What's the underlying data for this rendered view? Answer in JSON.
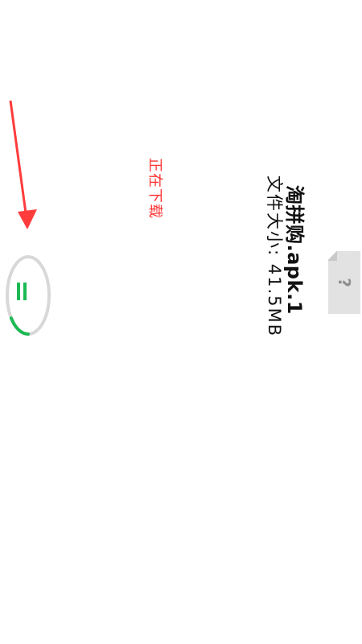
{
  "download": {
    "file_name": "淘拼购.apk.1",
    "file_size_label": "文件大小: 41.5MB",
    "status": "正在下载",
    "file_icon_glyph": "?",
    "progress": 0.15
  },
  "colors": {
    "accent_green": "#1db954",
    "status_red": "#ff3333",
    "ring_gray": "#d8d8d8",
    "arrow_red": "#ff3b3b"
  },
  "icons": [
    "file-icon",
    "pause-icon",
    "arrow-icon"
  ]
}
